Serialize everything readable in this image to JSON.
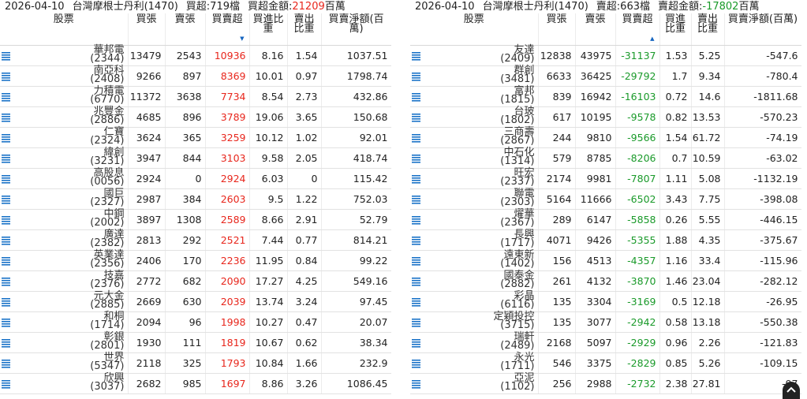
{
  "left": {
    "header": {
      "date": "2026-04-10",
      "broker": "台灣摩根士丹利(1470)",
      "net_buy_count": "買超:719檔",
      "amount_label": "買超金額:",
      "amount_value": "21209",
      "amount_unit": "百萬"
    },
    "columns": [
      "股票",
      "買張",
      "賣張",
      "買賣超",
      "買進比重",
      "賣出比重",
      "買賣淨額(百萬)"
    ],
    "rows": [
      {
        "name": "華邦電",
        "code": "(2344)",
        "buy": "13479",
        "sell": "2543",
        "net": "10936",
        "buy_pct": "8.16",
        "sell_pct": "1.54",
        "amount": "1037.51"
      },
      {
        "name": "南亞科",
        "code": "(2408)",
        "buy": "9266",
        "sell": "897",
        "net": "8369",
        "buy_pct": "10.01",
        "sell_pct": "0.97",
        "amount": "1798.74"
      },
      {
        "name": "力積電",
        "code": "(6770)",
        "buy": "11372",
        "sell": "3638",
        "net": "7734",
        "buy_pct": "8.54",
        "sell_pct": "2.73",
        "amount": "432.86"
      },
      {
        "name": "兆豐金",
        "code": "(2886)",
        "buy": "4685",
        "sell": "896",
        "net": "3789",
        "buy_pct": "19.06",
        "sell_pct": "3.65",
        "amount": "150.68"
      },
      {
        "name": "仁寶",
        "code": "(2324)",
        "buy": "3624",
        "sell": "365",
        "net": "3259",
        "buy_pct": "10.12",
        "sell_pct": "1.02",
        "amount": "92.01"
      },
      {
        "name": "緯創",
        "code": "(3231)",
        "buy": "3947",
        "sell": "844",
        "net": "3103",
        "buy_pct": "9.58",
        "sell_pct": "2.05",
        "amount": "418.74"
      },
      {
        "name": "高股息",
        "code": "(0056)",
        "buy": "2924",
        "sell": "0",
        "net": "2924",
        "buy_pct": "6.03",
        "sell_pct": "0",
        "amount": "115.42"
      },
      {
        "name": "國巨",
        "code": "(2327)",
        "buy": "2987",
        "sell": "384",
        "net": "2603",
        "buy_pct": "9.5",
        "sell_pct": "1.22",
        "amount": "752.03"
      },
      {
        "name": "中鋼",
        "code": "(2002)",
        "buy": "3897",
        "sell": "1308",
        "net": "2589",
        "buy_pct": "8.66",
        "sell_pct": "2.91",
        "amount": "52.79"
      },
      {
        "name": "廣達",
        "code": "(2382)",
        "buy": "2813",
        "sell": "292",
        "net": "2521",
        "buy_pct": "7.44",
        "sell_pct": "0.77",
        "amount": "814.21"
      },
      {
        "name": "英業達",
        "code": "(2356)",
        "buy": "2406",
        "sell": "170",
        "net": "2236",
        "buy_pct": "11.95",
        "sell_pct": "0.84",
        "amount": "99.22"
      },
      {
        "name": "技嘉",
        "code": "(2376)",
        "buy": "2772",
        "sell": "682",
        "net": "2090",
        "buy_pct": "17.27",
        "sell_pct": "4.25",
        "amount": "549.16"
      },
      {
        "name": "元大金",
        "code": "(2885)",
        "buy": "2669",
        "sell": "630",
        "net": "2039",
        "buy_pct": "13.74",
        "sell_pct": "3.24",
        "amount": "97.45"
      },
      {
        "name": "和桐",
        "code": "(1714)",
        "buy": "2094",
        "sell": "96",
        "net": "1998",
        "buy_pct": "10.27",
        "sell_pct": "0.47",
        "amount": "20.07"
      },
      {
        "name": "彰銀",
        "code": "(2801)",
        "buy": "1930",
        "sell": "111",
        "net": "1819",
        "buy_pct": "10.67",
        "sell_pct": "0.62",
        "amount": "38.34"
      },
      {
        "name": "世界",
        "code": "(5347)",
        "buy": "2118",
        "sell": "325",
        "net": "1793",
        "buy_pct": "10.84",
        "sell_pct": "1.66",
        "amount": "232.9"
      },
      {
        "name": "欣興",
        "code": "(3037)",
        "buy": "2682",
        "sell": "985",
        "net": "1697",
        "buy_pct": "8.86",
        "sell_pct": "3.26",
        "amount": "1086.45"
      }
    ]
  },
  "right": {
    "header": {
      "date": "2026-04-10",
      "broker": "台灣摩根士丹利(1470)",
      "net_sell_count": "賣超:663檔",
      "amount_label": "賣超金額:",
      "amount_value": "-17802",
      "amount_unit": "百萬"
    },
    "columns": [
      "股票",
      "買張",
      "賣張",
      "買賣超",
      "買進比重",
      "賣出比重",
      "買賣淨額(百萬)"
    ],
    "rows": [
      {
        "name": "友達",
        "code": "(2409)",
        "buy": "12838",
        "sell": "43975",
        "net": "-31137",
        "buy_pct": "1.53",
        "sell_pct": "5.25",
        "amount": "-547.6"
      },
      {
        "name": "群創",
        "code": "(3481)",
        "buy": "6633",
        "sell": "36425",
        "net": "-29792",
        "buy_pct": "1.7",
        "sell_pct": "9.34",
        "amount": "-780.4"
      },
      {
        "name": "富邦",
        "code": "(1815)",
        "buy": "839",
        "sell": "16942",
        "net": "-16103",
        "buy_pct": "0.72",
        "sell_pct": "14.6",
        "amount": "-1811.68"
      },
      {
        "name": "台玻",
        "code": "(1802)",
        "buy": "617",
        "sell": "10195",
        "net": "-9578",
        "buy_pct": "0.82",
        "sell_pct": "13.53",
        "amount": "-570.23"
      },
      {
        "name": "三商壽",
        "code": "(2867)",
        "buy": "244",
        "sell": "9810",
        "net": "-9566",
        "buy_pct": "1.54",
        "sell_pct": "61.72",
        "amount": "-74.19"
      },
      {
        "name": "中石化",
        "code": "(1314)",
        "buy": "579",
        "sell": "8785",
        "net": "-8206",
        "buy_pct": "0.7",
        "sell_pct": "10.59",
        "amount": "-63.02"
      },
      {
        "name": "旺宏",
        "code": "(2337)",
        "buy": "2174",
        "sell": "9981",
        "net": "-7807",
        "buy_pct": "1.11",
        "sell_pct": "5.08",
        "amount": "-1132.19"
      },
      {
        "name": "聯電",
        "code": "(2303)",
        "buy": "5164",
        "sell": "11666",
        "net": "-6502",
        "buy_pct": "3.43",
        "sell_pct": "7.75",
        "amount": "-398.08"
      },
      {
        "name": "燿華",
        "code": "(2367)",
        "buy": "289",
        "sell": "6147",
        "net": "-5858",
        "buy_pct": "0.26",
        "sell_pct": "5.55",
        "amount": "-446.15"
      },
      {
        "name": "長興",
        "code": "(1717)",
        "buy": "4071",
        "sell": "9426",
        "net": "-5355",
        "buy_pct": "1.88",
        "sell_pct": "4.35",
        "amount": "-375.67"
      },
      {
        "name": "遠東新",
        "code": "(1402)",
        "buy": "156",
        "sell": "4513",
        "net": "-4357",
        "buy_pct": "1.16",
        "sell_pct": "33.4",
        "amount": "-115.96"
      },
      {
        "name": "國泰金",
        "code": "(2882)",
        "buy": "261",
        "sell": "4132",
        "net": "-3870",
        "buy_pct": "1.46",
        "sell_pct": "23.04",
        "amount": "-282.12"
      },
      {
        "name": "彩晶",
        "code": "(6116)",
        "buy": "135",
        "sell": "3304",
        "net": "-3169",
        "buy_pct": "0.5",
        "sell_pct": "12.18",
        "amount": "-26.95"
      },
      {
        "name": "定穎投控",
        "code": "(3715)",
        "buy": "135",
        "sell": "3077",
        "net": "-2942",
        "buy_pct": "0.58",
        "sell_pct": "13.18",
        "amount": "-550.38"
      },
      {
        "name": "瑞軒",
        "code": "(2489)",
        "buy": "2168",
        "sell": "5097",
        "net": "-2929",
        "buy_pct": "0.96",
        "sell_pct": "2.26",
        "amount": "-121.83"
      },
      {
        "name": "永光",
        "code": "(1711)",
        "buy": "546",
        "sell": "3375",
        "net": "-2829",
        "buy_pct": "0.85",
        "sell_pct": "5.26",
        "amount": "-109.15"
      },
      {
        "name": "亞泥",
        "code": "(1102)",
        "buy": "256",
        "sell": "2988",
        "net": "-2732",
        "buy_pct": "2.38",
        "sell_pct": "27.81",
        "amount": "-97"
      }
    ]
  },
  "colors": {
    "positive": "#e8261c",
    "negative": "#1a9a2a",
    "menu_icon": "#1a73c8"
  },
  "icons": {
    "row_menu": "list-icon",
    "scroll_top": "chevron-up-icon"
  }
}
